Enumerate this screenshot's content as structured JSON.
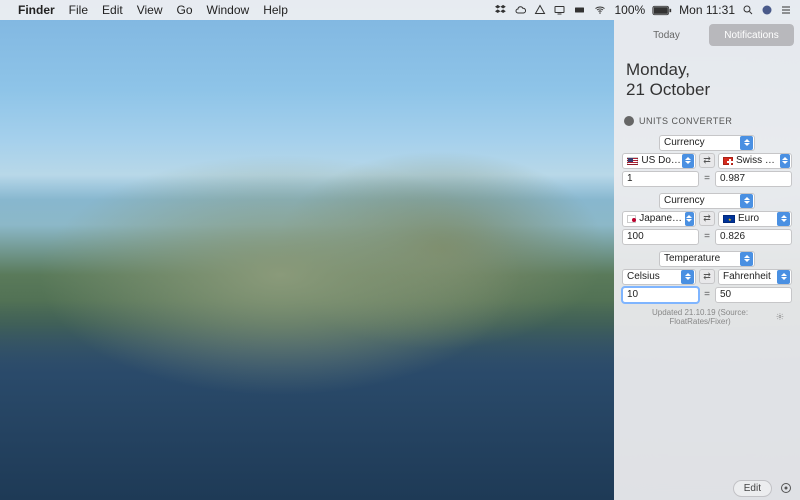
{
  "menubar": {
    "app_name": "Finder",
    "items": [
      "File",
      "Edit",
      "View",
      "Go",
      "Window",
      "Help"
    ],
    "battery": "100%",
    "clock": "Mon 11:31"
  },
  "nc": {
    "tabs": {
      "today": "Today",
      "notifications": "Notifications"
    },
    "date_line1": "Monday,",
    "date_line2": "21 October"
  },
  "widget": {
    "title": "UNITS CONVERTER",
    "sections": [
      {
        "category": "Currency",
        "flags": [
          "us",
          "ch"
        ],
        "from_unit": "US Dollar",
        "to_unit": "Swiss Franc",
        "from_val": "1",
        "to_val": "0.987"
      },
      {
        "category": "Currency",
        "flags": [
          "jp",
          "eu"
        ],
        "from_unit": "Japanese Y…",
        "to_unit": "Euro",
        "from_val": "100",
        "to_val": "0.826"
      },
      {
        "category": "Temperature",
        "flags": [
          null,
          null
        ],
        "from_unit": "Celsius",
        "to_unit": "Fahrenheit",
        "from_val": "10",
        "to_val": "50",
        "focus_from": true
      }
    ],
    "updated": "Updated 21.10.19 (Source: FloatRates/Fixer)"
  },
  "footer": {
    "edit": "Edit"
  },
  "equals": "="
}
